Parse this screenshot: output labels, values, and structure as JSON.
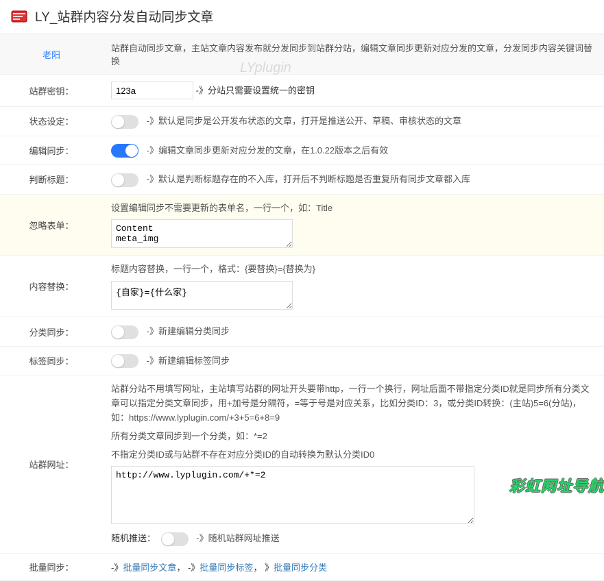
{
  "header": {
    "title": "LY_站群内容分发自动同步文章"
  },
  "info_row": {
    "author": "老阳",
    "desc": "站群自动同步文章，主站文章内容发布就分发同步到站群分站，编辑文章同步更新对应分发的文章，分发同步内容关键词替换"
  },
  "rows": {
    "secret": {
      "label": "站群密钥：",
      "value": "123a",
      "suffix": "-》分站只需要设置统一的密钥"
    },
    "status": {
      "label": "状态设定：",
      "desc": "-》默认是同步是公开发布状态的文章，打开是推送公开、草稿、审核状态的文章"
    },
    "edit_sync": {
      "label": "编辑同步：",
      "desc": "-》编辑文章同步更新对应分发的文章，在1.0.22版本之后有效"
    },
    "judge_title": {
      "label": "判断标题：",
      "desc": "-》默认是判断标题存在的不入库，打开后不判断标题是否重复所有同步文章都入库"
    },
    "ignore_form": {
      "label": "忽略表单：",
      "help": "设置编辑同步不需要更新的表单名，一行一个，如：Title",
      "value": "Content\nmeta_img"
    },
    "content_replace": {
      "label": "内容替换：",
      "help": "标题内容替换，一行一个，格式：{要替换}={替换为}",
      "value": "{自家}={什么家}"
    },
    "category_sync": {
      "label": "分类同步：",
      "desc": "-》新建编辑分类同步"
    },
    "tag_sync": {
      "label": "标签同步：",
      "desc": "-》新建编辑标签同步"
    },
    "site_url": {
      "label": "站群网址：",
      "help1": "站群分站不用填写网址，主站填写站群的网址开头要带http，一行一个换行，网址后面不带指定分类ID就是同步所有分类文章可以指定分类文章同步，用+加号是分隔符，=等于号是对应关系，比如分类ID：3，或分类ID转换：(主站)5=6(分站)，如：https://www.lyplugin.com/+3+5=6+8=9",
      "help2": "所有分类文章同步到一个分类，如：*=2",
      "help3": "不指定分类ID或与站群不存在对应分类ID的自动转换为默认分类ID0",
      "value": "http://www.lyplugin.com/+*=2",
      "random_push_label": "随机推送：",
      "random_push_desc": "-》随机站群网址推送"
    },
    "batch_sync": {
      "label": "批量同步：",
      "prefix1": "-》",
      "link1": "批量同步文章",
      "sep1": "， -》",
      "link2": "批量同步标签",
      "sep2": "， 》",
      "link3": "批量同步分类"
    }
  },
  "watermarks": {
    "center": "LYplugin",
    "bottom": "彩虹网址导航"
  }
}
